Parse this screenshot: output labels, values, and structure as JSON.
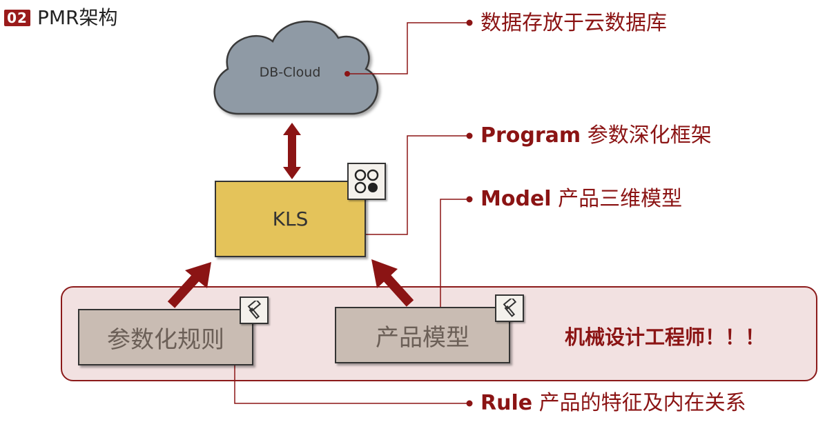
{
  "header": {
    "badge": "02",
    "title": "PMR架构"
  },
  "nodes": {
    "cloud": "DB-Cloud",
    "kls": "KLS",
    "rule_box": "参数化规则",
    "model_box": "产品模型"
  },
  "callouts": {
    "cloud": {
      "text": "数据存放于云数据库"
    },
    "program": {
      "keyword": "Program",
      "text": "参数深化框架"
    },
    "model": {
      "keyword": "Model",
      "text": "产品三维模型"
    },
    "rule": {
      "keyword": "Rule",
      "text": "产品的特征及内在关系"
    }
  },
  "group_label": "机械设计工程师！！！",
  "icons": {
    "kls_badge": "four-circles-icon",
    "rule_badge": "hammer-icon",
    "model_badge": "hammer-icon"
  },
  "colors": {
    "accent": "#8b1414",
    "kls_fill": "#e4c35a",
    "box_fill": "#c9bcb3",
    "cloud_fill": "#8f9aa5",
    "group_fill": "#f2e1e1"
  }
}
